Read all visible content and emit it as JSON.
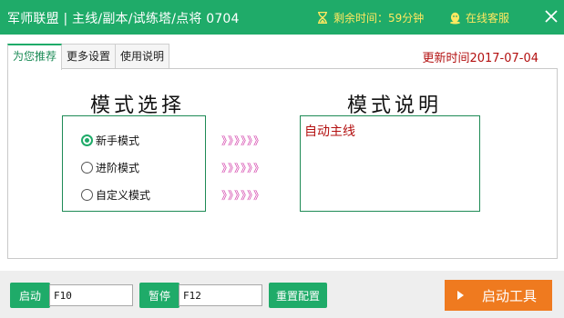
{
  "titlebar": {
    "title": "军师联盟 | 主线/副本/试练塔/点将 0704",
    "time_left": "剩余时间：59分钟",
    "online_support": "在线客服"
  },
  "tabs": [
    {
      "label": "为您推荐",
      "active": true
    },
    {
      "label": "更多设置",
      "active": false
    },
    {
      "label": "使用说明",
      "active": false
    }
  ],
  "update_time": "更新时间2017-07-04",
  "mode_select": {
    "heading": "模式选择",
    "options": [
      {
        "label": "新手模式",
        "checked": true
      },
      {
        "label": "进阶模式",
        "checked": false
      },
      {
        "label": "自定义模式",
        "checked": false
      }
    ],
    "arrows": "》》》》》》"
  },
  "mode_desc": {
    "heading": "模式说明",
    "text": "自动主线"
  },
  "bottom": {
    "start_label": "启动",
    "start_key": "F10",
    "pause_label": "暂停",
    "pause_key": "F12",
    "reset_label": "重置配置",
    "start_tool_label": "启动工具"
  },
  "colors": {
    "accent": "#1fab69",
    "highlight": "#ffe860",
    "red_text": "#b31010",
    "arrow": "#d23ca8",
    "orange": "#ef7a1f"
  }
}
